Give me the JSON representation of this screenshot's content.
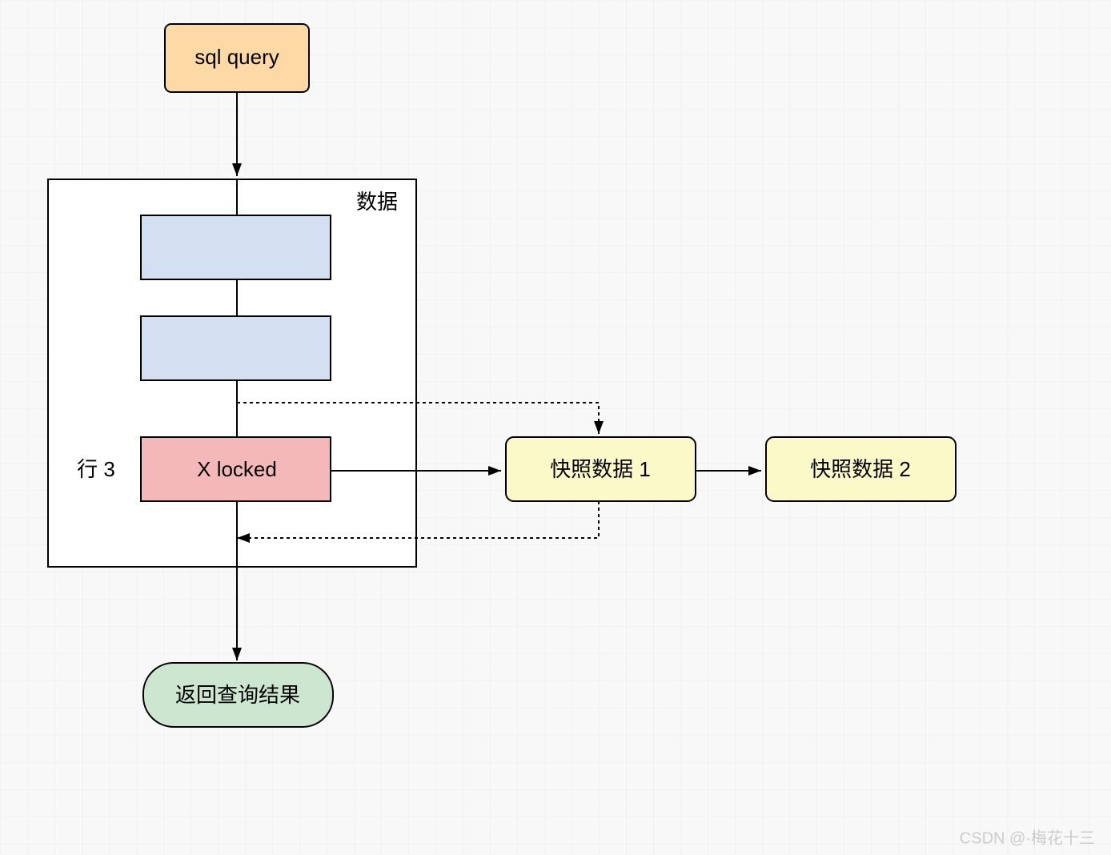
{
  "nodes": {
    "sql_query": "sql query",
    "data_container_label": "数据",
    "row3_label": "行 3",
    "x_locked": "X locked",
    "snapshot1": "快照数据 1",
    "snapshot2": "快照数据 2",
    "result": "返回查询结果"
  },
  "watermark": "CSDN @·梅花十三"
}
